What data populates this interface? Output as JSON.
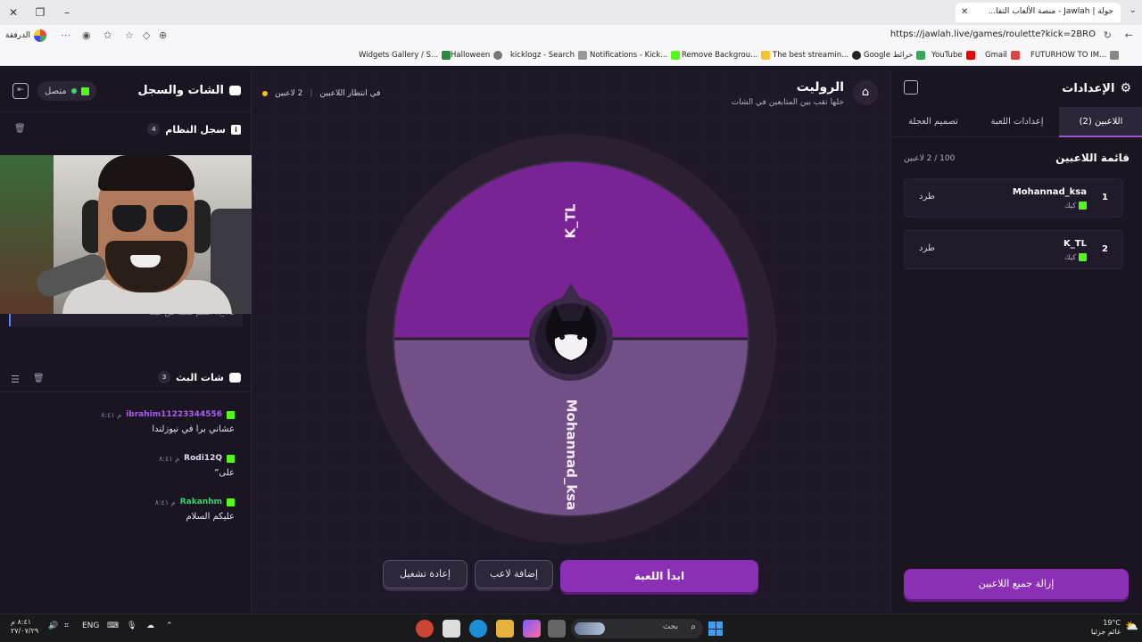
{
  "browser": {
    "tab_title": "جولة | Jawlah - منصة الألعاب التفا...",
    "profile_label": "الدرفقة",
    "url": "https://jawlah.live/games/roulette?kick=2BRO",
    "bookmarks": [
      "Widgets Gallery / S...",
      "Halloween",
      "kicklogz - Search",
      "Notifications - Kick...",
      "Remove Backgrou...",
      "The best streamin...",
      "Google خرائط",
      "YouTube",
      "Gmail",
      "FUTURHOW TO IM..."
    ]
  },
  "chat_panel": {
    "title": "الشات والسجل",
    "status": "متصل",
    "system_log": {
      "title": "سجل النظام",
      "count": "4",
      "entry": "K_TL انضم للعبة من كيك"
    },
    "stream_chat": {
      "title": "شات البث",
      "count": "3",
      "messages": [
        {
          "user": "ibrahim11223344556",
          "time": "م ٨:٤١",
          "text": "عشاني برا في نيوزلندا",
          "color": "#a95df5"
        },
        {
          "user": "Rodi12Q",
          "time": "م ٨:٤١",
          "text": "على”",
          "color": "#e0d7ec"
        },
        {
          "user": "Rakanhm",
          "time": "م ٨:٤١",
          "text": "عليكم السلام",
          "color": "#3bd16f"
        }
      ]
    }
  },
  "game": {
    "title": "الروليت",
    "subtitle": "خلها تقب بين المتابعين في الشات",
    "players_status": "2 لاعبين",
    "state": "في انتظار اللاعبين",
    "segments": [
      {
        "name": "K_TL",
        "color": "#7a2394"
      },
      {
        "name": "Mohannad_ksa",
        "color": "#734f87"
      }
    ],
    "start_button": "ابدأ اللعبة",
    "add_player_button": "إضافة لاعب",
    "reset_button": "إعادة تشغيل"
  },
  "settings": {
    "title": "الإعدادات",
    "tabs": [
      "اللاعبين (2)",
      "إعدادات اللعبة",
      "تصميم العجلة"
    ],
    "list_title": "قائمة اللاعبين",
    "list_count": "100 / 2 لاعبين",
    "players": [
      {
        "num": "1",
        "name": "Mohannad_ksa",
        "platform": "كيك",
        "action": "طرد"
      },
      {
        "num": "2",
        "name": "K_TL",
        "platform": "كيك",
        "action": "طرد"
      }
    ],
    "remove_all_button": "إزالة جميع اللاعبين"
  },
  "taskbar": {
    "time": "٨:٤١ م",
    "date": "٢٧/٠٧/٢٩",
    "lang": "ENG",
    "search": "بحث",
    "weather_temp": "19°C",
    "weather_desc": "غائم جزئيا"
  }
}
